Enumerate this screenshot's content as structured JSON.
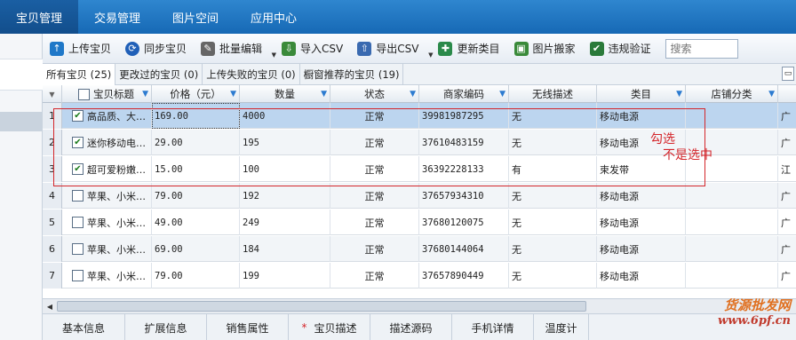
{
  "topnav": {
    "items": [
      "宝贝管理",
      "交易管理",
      "图片空间",
      "应用中心"
    ]
  },
  "toolbar": {
    "buttons": [
      {
        "label": "上传宝贝",
        "icon": "upload-icon",
        "color": "#1f78c8"
      },
      {
        "label": "同步宝贝",
        "icon": "sync-icon",
        "color": "#2060b8"
      },
      {
        "label": "批量编辑",
        "icon": "batch-edit-icon",
        "color": "#555555"
      },
      {
        "label": "导入CSV",
        "icon": "import-csv-icon",
        "color": "#3a8a3a"
      },
      {
        "label": "导出CSV",
        "icon": "export-csv-icon",
        "color": "#3a6ab0"
      },
      {
        "label": "更新类目",
        "icon": "update-category-icon",
        "color": "#2a8a4a"
      },
      {
        "label": "图片搬家",
        "icon": "image-move-icon",
        "color": "#3a8a3a"
      },
      {
        "label": "违规验证",
        "icon": "violation-check-icon",
        "color": "#2a7a3a"
      }
    ],
    "search_placeholder": "搜索"
  },
  "tabs": [
    "所有宝贝 (25)",
    "更改过的宝贝 (0)",
    "上传失败的宝贝 (0)",
    "橱窗推荐的宝贝 (19)"
  ],
  "table": {
    "headers": [
      "宝贝标题",
      "价格（元）",
      "数量",
      "状态",
      "商家编码",
      "无线描述",
      "类目",
      "店铺分类"
    ],
    "rows": [
      {
        "num": "1",
        "checked": true,
        "title": "高品质、大…",
        "price": "169.00",
        "qty": "4000",
        "status": "正常",
        "code": "39981987295",
        "wireless": "无",
        "category": "移动电源",
        "shop": "广"
      },
      {
        "num": "2",
        "checked": true,
        "title": "迷你移动电…",
        "price": "29.00",
        "qty": "195",
        "status": "正常",
        "code": "37610483159",
        "wireless": "无",
        "category": "移动电源",
        "shop": "广"
      },
      {
        "num": "3",
        "checked": true,
        "title": "超可爱粉嫩…",
        "price": "15.00",
        "qty": "100",
        "status": "正常",
        "code": "36392228133",
        "wireless": "有",
        "category": "束发带",
        "shop": "江"
      },
      {
        "num": "4",
        "checked": false,
        "title": "苹果、小米…",
        "price": "79.00",
        "qty": "192",
        "status": "正常",
        "code": "37657934310",
        "wireless": "无",
        "category": "移动电源",
        "shop": "广"
      },
      {
        "num": "5",
        "checked": false,
        "title": "苹果、小米…",
        "price": "49.00",
        "qty": "249",
        "status": "正常",
        "code": "37680120075",
        "wireless": "无",
        "category": "移动电源",
        "shop": "广"
      },
      {
        "num": "6",
        "checked": false,
        "title": "苹果、小米…",
        "price": "69.00",
        "qty": "184",
        "status": "正常",
        "code": "37680144064",
        "wireless": "无",
        "category": "移动电源",
        "shop": "广"
      },
      {
        "num": "7",
        "checked": false,
        "title": "苹果、小米…",
        "price": "79.00",
        "qty": "199",
        "status": "正常",
        "code": "37657890449",
        "wireless": "无",
        "category": "移动电源",
        "shop": "广"
      }
    ]
  },
  "annotation": {
    "line1": "勾选",
    "line2": "不是选中"
  },
  "bottom_tabs": [
    "基本信息",
    "扩展信息",
    "销售属性",
    "宝贝描述",
    "描述源码",
    "手机详情",
    "温度计"
  ],
  "watermark": {
    "line1": "货源批发网",
    "line2": "www.6pf.cn"
  }
}
